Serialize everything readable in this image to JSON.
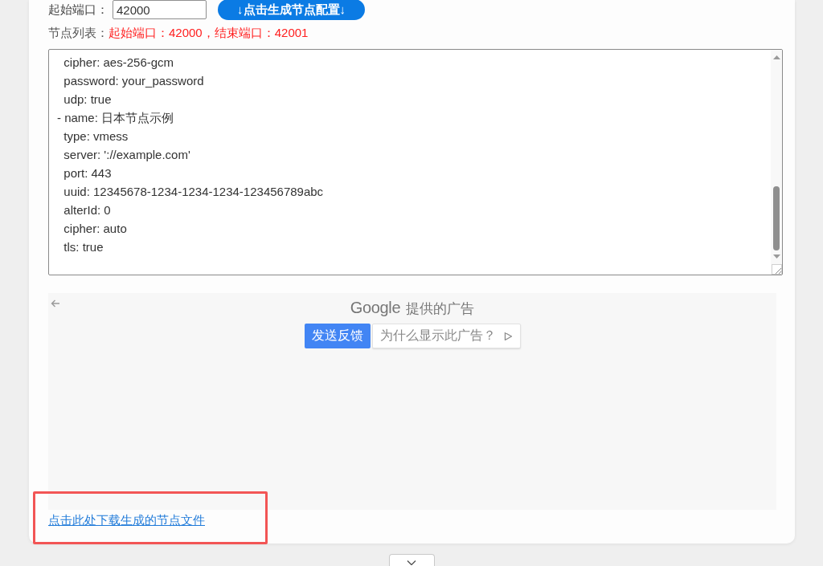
{
  "port_form": {
    "start_port_label": "起始端口：",
    "start_port_value": "42000",
    "generate_button": "↓点击生成节点配置↓"
  },
  "node_list_status": {
    "label": "节点列表：",
    "summary": "起始端口：42000，结束端口：42001"
  },
  "config_output": {
    "lines": [
      "  cipher: aes-256-gcm",
      "  password: your_password",
      "  udp: true",
      "- name: 日本节点示例",
      "  type: vmess",
      "  server: '://example.com'",
      "  port: 443",
      "  uuid: 12345678-1234-1234-1234-123456789abc",
      "  alterId: 0",
      "  cipher: auto",
      "  tls: true"
    ]
  },
  "ad_panel": {
    "provider": "Google",
    "heading": "提供的广告",
    "feedback_button": "发送反馈",
    "why_button": "为什么显示此广告？"
  },
  "download_link": {
    "label": "点击此处下载生成的节点文件",
    "highlighted": true
  }
}
